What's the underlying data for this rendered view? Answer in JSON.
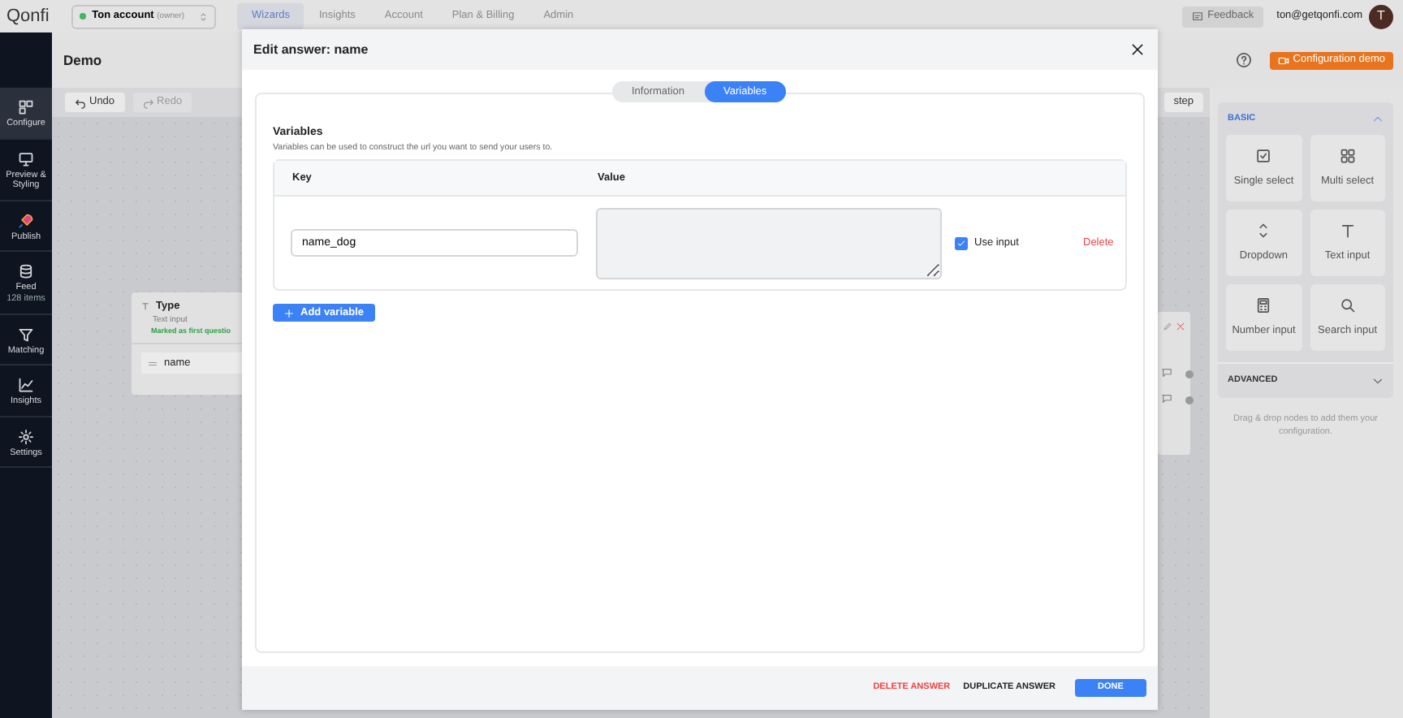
{
  "app": {
    "logo": "Qonfi",
    "account": {
      "name": "Ton account",
      "role": "(owner)"
    },
    "nav_tabs": [
      {
        "label": "Wizards",
        "selected": true
      },
      {
        "label": "Insights",
        "selected": false
      },
      {
        "label": "Account",
        "selected": false
      },
      {
        "label": "Plan & Billing",
        "selected": false
      },
      {
        "label": "Admin",
        "selected": false
      }
    ],
    "feedback": "Feedback",
    "user_email": "ton@getqonfi.com",
    "avatar": "T"
  },
  "sidebar": {
    "items": [
      {
        "label": "Configure",
        "selected": true
      },
      {
        "label": "Preview & Styling",
        "selected": false
      },
      {
        "label": "Publish",
        "selected": false
      },
      {
        "label": "Feed",
        "sub": "128 items",
        "selected": false
      },
      {
        "label": "Matching",
        "selected": false
      },
      {
        "label": "Insights",
        "selected": false
      },
      {
        "label": "Settings",
        "selected": false
      }
    ]
  },
  "header": {
    "title": "Demo",
    "demo_button": "Configuration demo"
  },
  "toolbar": {
    "undo": "Undo",
    "redo": "Redo",
    "step_fragment": "step"
  },
  "canvas_node": {
    "title": "Type",
    "type": "Text input",
    "note": "Marked as first questio",
    "answer": "name"
  },
  "palette": {
    "sections": [
      {
        "title": "BASIC",
        "expanded": true,
        "items": [
          {
            "label": "Single select"
          },
          {
            "label": "Multi select"
          },
          {
            "label": "Dropdown"
          },
          {
            "label": "Text input"
          },
          {
            "label": "Number input"
          },
          {
            "label": "Search input"
          }
        ]
      },
      {
        "title": "ADVANCED",
        "expanded": false
      }
    ],
    "hint": "Drag & drop nodes to add them your configuration."
  },
  "dialog": {
    "title": "Edit answer: name",
    "tabs": [
      {
        "label": "Information",
        "selected": false
      },
      {
        "label": "Variables",
        "selected": true
      }
    ],
    "section_title": "Variables",
    "section_description": "Variables can be used to construct the url you want to send your users to.",
    "columns": [
      "Key",
      "Value"
    ],
    "rows": [
      {
        "key": "name_dog",
        "use_input_label": "Use input",
        "use_input": true,
        "delete": "Delete"
      }
    ],
    "add_button": "Add variable",
    "footer": {
      "delete": "DELETE ANSWER",
      "duplicate": "DUPLICATE ANSWER",
      "done": "DONE"
    }
  }
}
